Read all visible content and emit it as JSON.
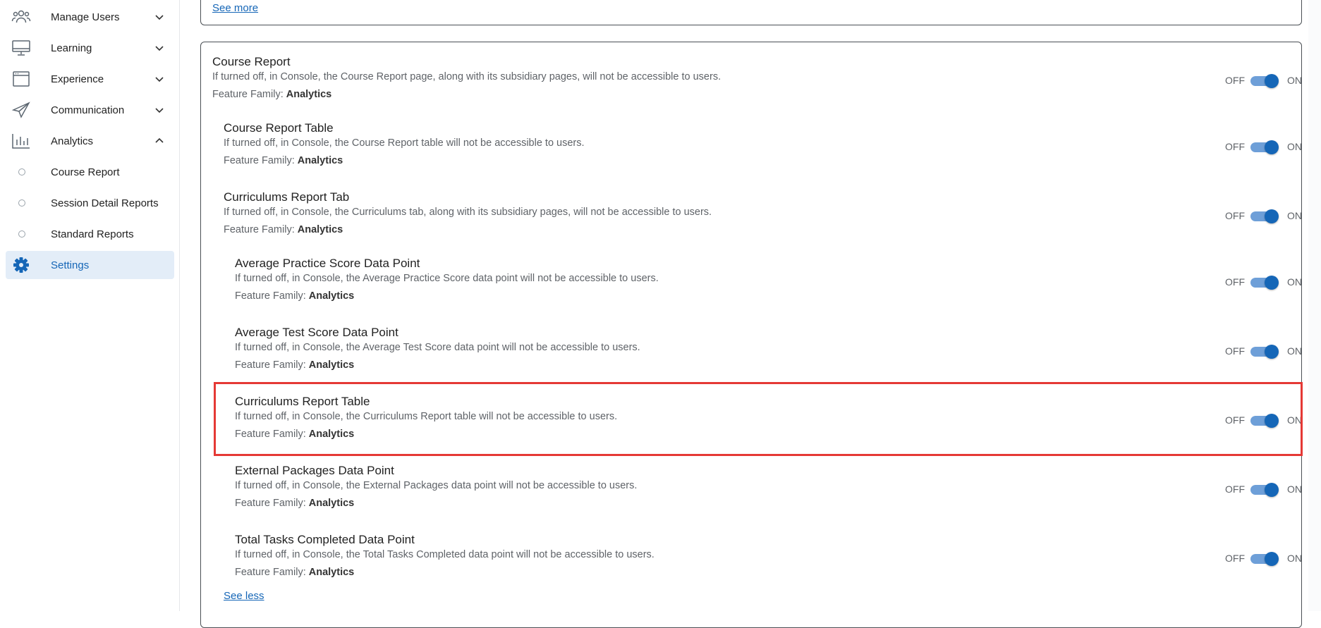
{
  "sidebar": {
    "items": [
      {
        "label": "Manage Users",
        "icon": "users-icon",
        "expanded": false
      },
      {
        "label": "Learning",
        "icon": "monitor-icon",
        "expanded": false
      },
      {
        "label": "Experience",
        "icon": "browser-window-icon",
        "expanded": false
      },
      {
        "label": "Communication",
        "icon": "paper-plane-icon",
        "expanded": false
      },
      {
        "label": "Analytics",
        "icon": "bar-chart-icon",
        "expanded": true
      }
    ],
    "analytics_sub": [
      {
        "label": "Course Report"
      },
      {
        "label": "Session Detail Reports"
      },
      {
        "label": "Standard Reports"
      }
    ],
    "settings": {
      "label": "Settings",
      "icon": "gear-icon",
      "active": true
    }
  },
  "top_card": {
    "see_more": "See more "
  },
  "features": [
    {
      "title": "Course Report",
      "desc": "If turned off, in Console, the Course Report page, along with its subsidiary pages, will not be accessible to users.",
      "family_label": "Feature Family: ",
      "family": "Analytics",
      "enabled": true
    },
    {
      "title": "Course Report Table",
      "desc": "If turned off, in Console, the Course Report table will not be accessible to users.",
      "family_label": "Feature Family: ",
      "family": "Analytics",
      "enabled": true
    },
    {
      "title": "Curriculums Report Tab",
      "desc": "If turned off, in Console, the Curriculums tab, along with its subsidiary pages, will not be accessible to users.",
      "family_label": "Feature Family: ",
      "family": "Analytics",
      "enabled": true
    },
    {
      "title": "Average Practice Score Data Point",
      "desc": "If turned off, in Console, the Average Practice Score data point will not be accessible to users.",
      "family_label": "Feature Family: ",
      "family": "Analytics",
      "enabled": true
    },
    {
      "title": "Average Test Score Data Point",
      "desc": "If turned off, in Console, the Average Test Score data point will not be accessible to users.",
      "family_label": "Feature Family: ",
      "family": "Analytics",
      "enabled": true
    },
    {
      "title": "Curriculums Report Table",
      "desc": "If turned off, in Console, the Curriculums Report table will not be accessible to users.",
      "family_label": "Feature Family: ",
      "family": "Analytics",
      "enabled": true
    },
    {
      "title": "External Packages Data Point",
      "desc": "If turned off, in Console, the External Packages data point will not be accessible to users.",
      "family_label": "Feature Family: ",
      "family": "Analytics",
      "enabled": true
    },
    {
      "title": "Total Tasks Completed Data Point",
      "desc": "If turned off, in Console, the Total Tasks Completed data point will not be accessible to users.",
      "family_label": "Feature Family: ",
      "family": "Analytics",
      "enabled": true
    }
  ],
  "toggle_labels": {
    "off": "OFF",
    "on": "ON"
  },
  "see_less": "See less ",
  "colors": {
    "accent": "#1566b7",
    "toggle_track": "#6e9fd8",
    "highlight": "#e53935",
    "active_bg": "#e3edf8"
  }
}
